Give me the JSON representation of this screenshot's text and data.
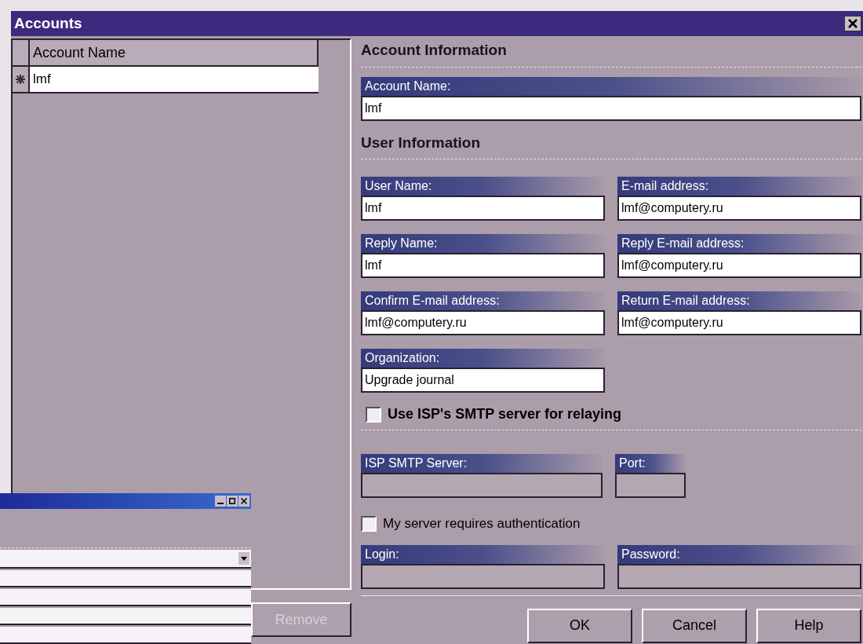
{
  "window": {
    "title": "Accounts"
  },
  "account_list": {
    "columns": [
      "Account Name"
    ],
    "rows": [
      {
        "account_name": "lmf"
      }
    ]
  },
  "account_information": {
    "heading": "Account Information",
    "fields": [
      {
        "label": "Account Name:",
        "value": "lmf",
        "disabled": false
      }
    ]
  },
  "user_information": {
    "heading": "User Information",
    "fields": [
      {
        "label": "User Name:",
        "value": "lmf",
        "disabled": false
      },
      {
        "label": "E-mail address:",
        "value": "lmf@computery.ru",
        "disabled": false
      },
      {
        "label": "Reply Name:",
        "value": "lmf",
        "disabled": false
      },
      {
        "label": "Reply E-mail address:",
        "value": "lmf@computery.ru",
        "disabled": false
      },
      {
        "label": "Confirm E-mail address:",
        "value": "lmf@computery.ru",
        "disabled": false
      },
      {
        "label": "Return E-mail address:",
        "value": "lmf@computery.ru",
        "disabled": false
      },
      {
        "label": "Organization:",
        "value": "Upgrade journal",
        "disabled": false
      }
    ],
    "relay_checkbox": {
      "label": "Use ISP's SMTP server for relaying",
      "checked": false
    }
  },
  "smtp": {
    "server_field": {
      "label": "ISP SMTP Server:",
      "disabled": true
    },
    "port_field": {
      "label": "Port:",
      "disabled": true
    },
    "auth_checkbox": {
      "label": "My server requires authentication",
      "checked": false
    },
    "auth_fields": [
      {
        "label": "Login:",
        "disabled": true
      },
      {
        "label": "Password:",
        "disabled": true
      }
    ]
  },
  "remove_button": {
    "label": "Remove",
    "disabled": true
  },
  "buttons": [
    {
      "label": "OK",
      "disabled": false
    },
    {
      "label": "Cancel",
      "disabled": false
    },
    {
      "label": "Help",
      "disabled": false
    }
  ],
  "background_window": {
    "fields": [
      {
        "kind": "dropdown"
      },
      {
        "kind": "text"
      },
      {
        "kind": "text"
      },
      {
        "kind": "text"
      },
      {
        "kind": "text"
      }
    ]
  }
}
